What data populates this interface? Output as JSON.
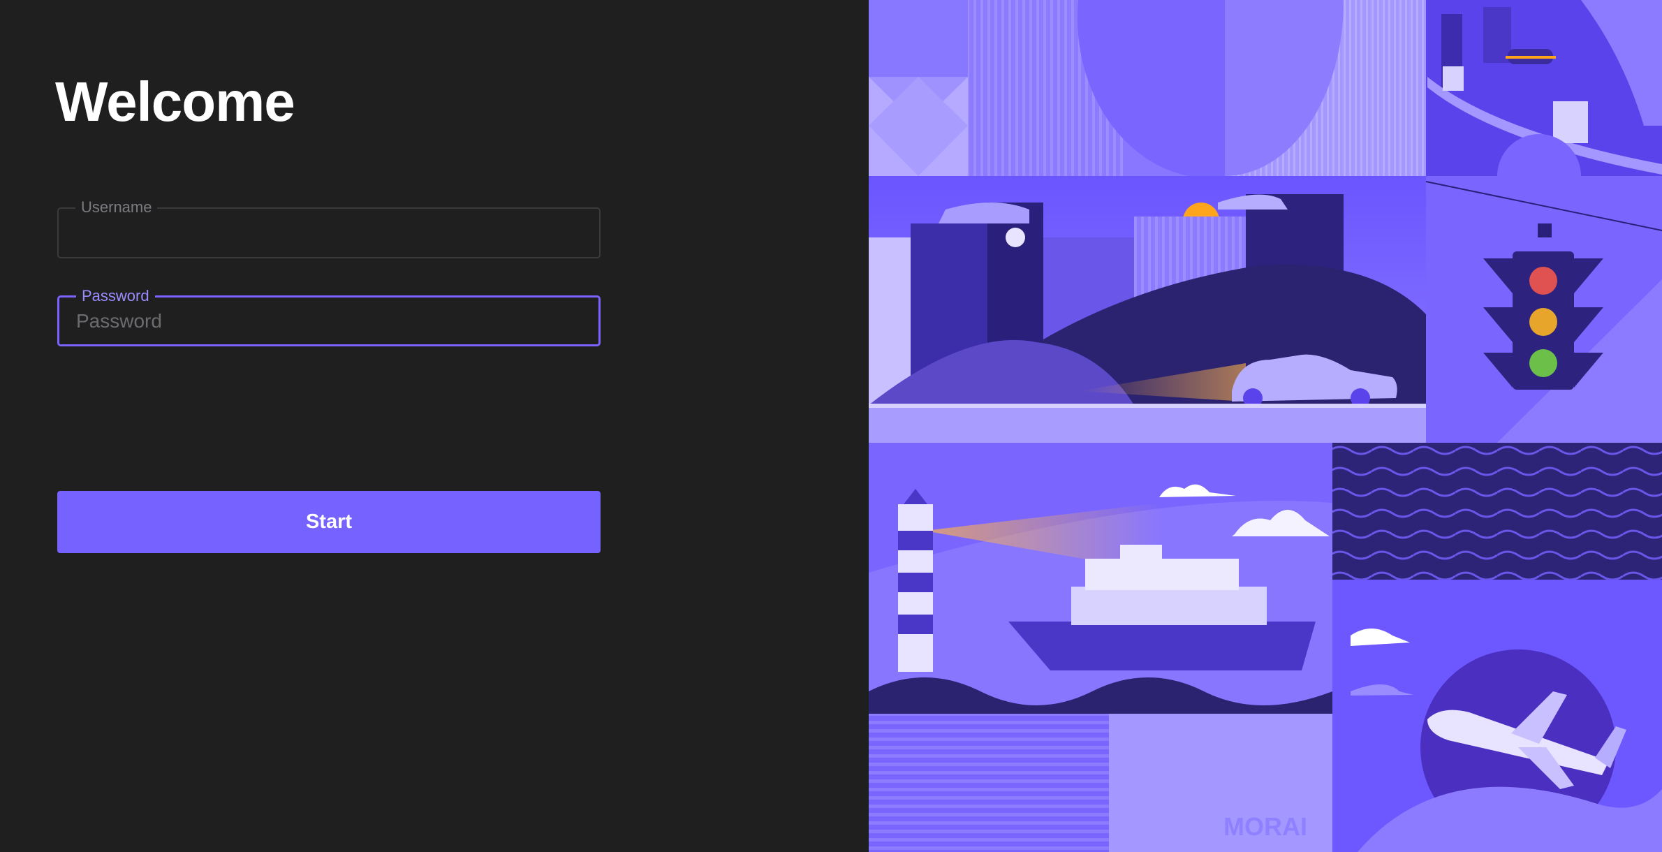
{
  "login": {
    "title": "Welcome",
    "username": {
      "label": "Username",
      "value": "",
      "placeholder": ""
    },
    "password": {
      "label": "Password",
      "value": "",
      "placeholder": "Password"
    },
    "start_label": "Start"
  },
  "artwork": {
    "brand_watermark": "MORAI",
    "scenes": [
      "abstract-shapes",
      "city-monorail",
      "city-skyline-car",
      "traffic-light",
      "lighthouse-ship",
      "waves-pattern",
      "airplane",
      "striped-panel"
    ]
  },
  "colors": {
    "background": "#1f1f20",
    "accent": "#7562ff",
    "focus_border": "#7a63ff",
    "focus_label": "#9b8cff",
    "muted_label": "#7b7b80",
    "traffic_red": "#e05252",
    "traffic_yellow": "#e8a52c",
    "traffic_green": "#6cc04a",
    "sun": "#ffa51c"
  }
}
